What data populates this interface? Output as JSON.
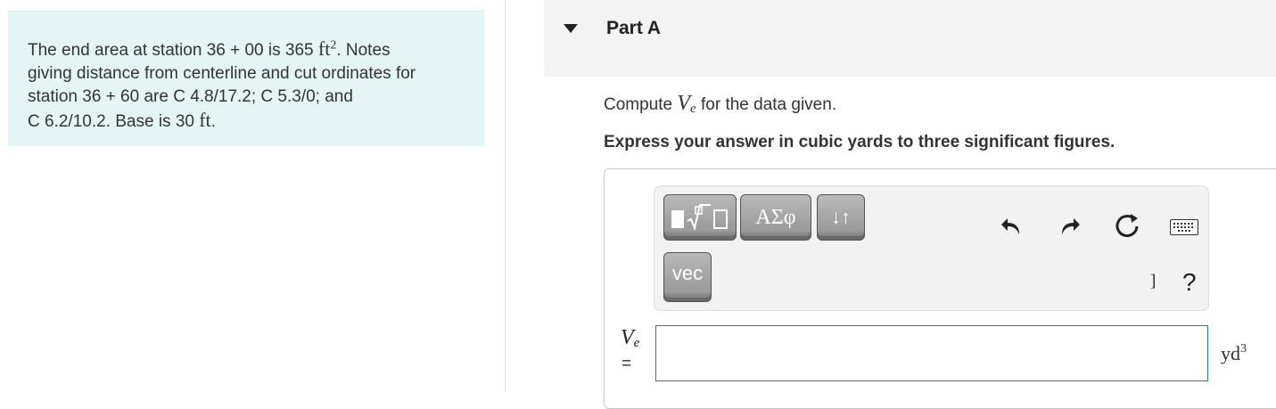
{
  "problem": {
    "line1_pre": "The end area at station 36 + 00 is 365 ",
    "line1_unit": "ft",
    "line1_exp": "2",
    "line1_post": ". Notes",
    "line2": "giving distance from centerline and cut ordinates for",
    "line3": "station 36 + 60 are C 4.8/17.2; C 5.3/0; and",
    "line4_pre": "C 6.2/10.2. Base is 30 ",
    "line4_unit": "ft",
    "line4_post": "."
  },
  "part": {
    "title": "Part A"
  },
  "prompt": {
    "pre": "Compute ",
    "var": "V",
    "var_sub": "e",
    "post": " for the data given."
  },
  "instruction": "Express your answer in cubic yards to three significant figures.",
  "toolbar": {
    "templates_label": "▮√□",
    "greek_label": "ΑΣφ",
    "arrows_label": "↓↑",
    "vec_label": "vec",
    "undo_icon": "undo-icon",
    "redo_icon": "redo-icon",
    "reset_icon": "reset-icon",
    "keyboard_icon": "keyboard-icon",
    "bracket_label": "]",
    "help_label": "?"
  },
  "answer": {
    "var": "V",
    "var_sub": "e",
    "equals": "=",
    "value": "",
    "unit": "yd",
    "unit_exp": "3"
  },
  "colors": {
    "problem_bg": "#e4f5f5",
    "header_bg": "#f3f3f3",
    "input_border": "#2e7d8c"
  }
}
